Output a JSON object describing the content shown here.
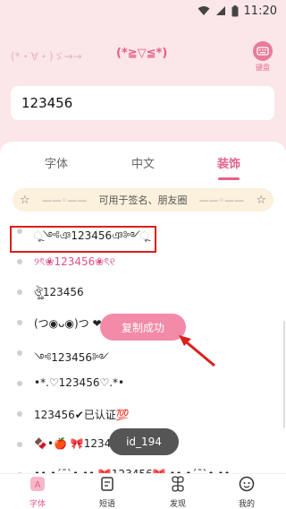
{
  "status_bar": {
    "time": "11:20"
  },
  "header": {
    "kaomoji_left": "(*・∀・)ゞ→→",
    "kaomoji_right": "(*≧▽≦*)",
    "keyboard_label": "键盘"
  },
  "input": {
    "value": "123456"
  },
  "tabs": [
    {
      "label": "字体",
      "active": false
    },
    {
      "label": "中文",
      "active": false
    },
    {
      "label": "装饰",
      "active": true
    }
  ],
  "banner": {
    "left_star": "☆",
    "text": "可用于签名、朋友圈",
    "right_star": "☆"
  },
  "list_items": [
    {
      "text": "ૂ༺ঞ123456ঞ༻ૂ"
    },
    {
      "text": "୨ৎ❀123456❀ৎ୧"
    },
    {
      "text": "ঔৣ123456"
    },
    {
      "text": "(つ◉ᴗ◉)つ ❤"
    },
    {
      "text": "༺123456༻"
    },
    {
      "text": "•*.♡123456♡.*•"
    },
    {
      "text": "123456✔已认证💯"
    },
    {
      "text": "🍫•🍎 🎀123456🎀 •🍫"
    },
    {
      "text": "••.•´¯`•.•• 🎀123456🎀 ••.•´¯`•.••"
    }
  ],
  "toasts": {
    "copy_success": "复制成功",
    "id_label": "id_194"
  },
  "bottom_nav": [
    {
      "label": "字体",
      "icon": "font-icon",
      "active": true
    },
    {
      "label": "短语",
      "icon": "phrase-icon",
      "active": false
    },
    {
      "label": "发现",
      "icon": "discover-icon",
      "active": false
    },
    {
      "label": "我的",
      "icon": "profile-icon",
      "active": false
    }
  ],
  "colors": {
    "accent": "#e5628a",
    "background": "#fbe6ea",
    "highlight_border": "#d9201e",
    "toast_pink": "#f28aa8"
  }
}
